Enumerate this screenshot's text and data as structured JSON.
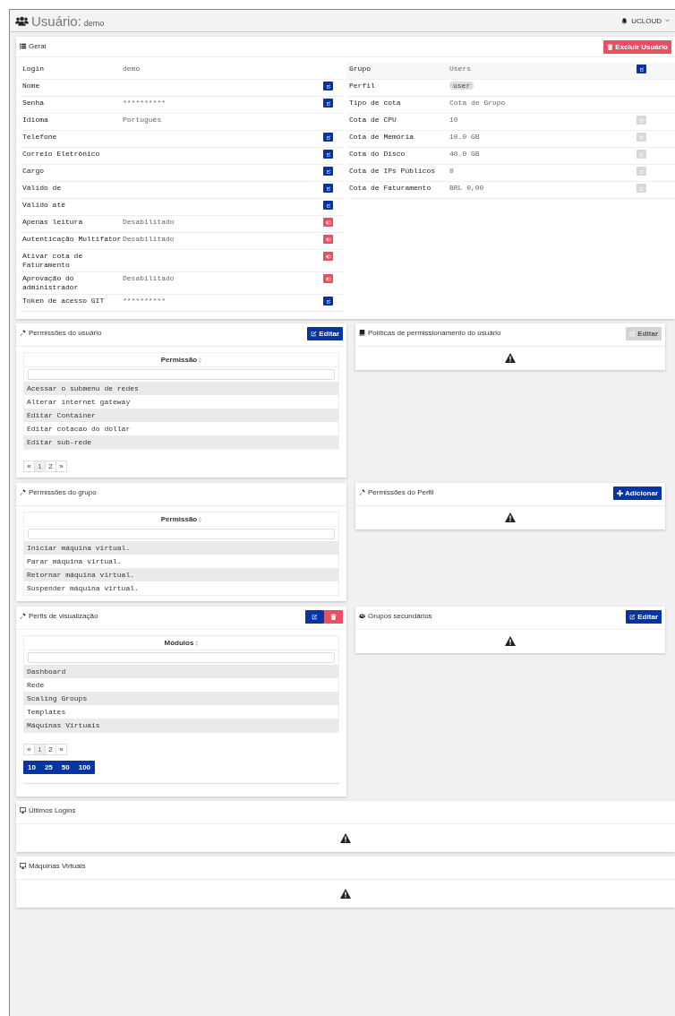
{
  "header": {
    "title": "Usuário:",
    "subtitle": "demo",
    "user": "UCLOUD"
  },
  "general": {
    "title": "Geral",
    "delete_button": "Excluir Usuário",
    "left_fields": [
      {
        "label": "Login",
        "value": "demo",
        "kind": "plain"
      },
      {
        "label": "Nome",
        "kind": "edit"
      },
      {
        "label": "Senha",
        "value": "**********",
        "kind": "edit"
      },
      {
        "label": "Idioma",
        "value": "Português",
        "kind": "plain"
      },
      {
        "label": "Telefone",
        "kind": "edit"
      },
      {
        "label": "Correio Eletrônico",
        "kind": "edit"
      },
      {
        "label": "Cargo",
        "kind": "edit"
      },
      {
        "label": "Válido de",
        "kind": "edit"
      },
      {
        "label": "Válido até",
        "kind": "edit"
      },
      {
        "label": "Apenas leitura",
        "value": "Desabilitado",
        "kind": "toggle"
      },
      {
        "label": "Autenticação Multifator",
        "value": "Desabilitado",
        "kind": "toggle"
      },
      {
        "label": "Ativar cota de Faturamento",
        "kind": "toggle"
      },
      {
        "label": "Aprovação do administrador",
        "value": "Desabilitado",
        "kind": "toggle"
      },
      {
        "label": "Token de acesso GIT",
        "value": "**********",
        "kind": "edit"
      }
    ],
    "right_fields": [
      {
        "label": "Grupo",
        "value": "Users",
        "kind": "edit",
        "disabled": false
      },
      {
        "label": "Perfil",
        "value": "user",
        "kind": "badge"
      },
      {
        "label": "Tipo de cota",
        "value": "Cota de Grupo",
        "kind": "plain"
      },
      {
        "label": "Cota de CPU",
        "value": "10",
        "kind": "edit",
        "disabled": true
      },
      {
        "label": "Cota de Memória",
        "value": "10.0 GB",
        "kind": "edit",
        "disabled": true
      },
      {
        "label": "Cota do Disco",
        "value": "40.0 GB",
        "kind": "edit",
        "disabled": true
      },
      {
        "label": "Cota de IPs Públicos",
        "value": "0",
        "kind": "edit",
        "disabled": true
      },
      {
        "label": "Cota de Faturamento",
        "value": "BRL 0,00",
        "kind": "edit",
        "disabled": true
      }
    ]
  },
  "panels": [
    {
      "title": "Permissões do usuário",
      "kind": "table",
      "buttons": [
        {
          "kind": "edit",
          "label": "Editar",
          "disabled": false
        }
      ],
      "column": "Permissão",
      "rows": [
        "Acessar o submenu de redes",
        "Alterar internet gateway",
        "Editar Container",
        "Editar cotacao do dollar",
        "Editar sub-rede"
      ],
      "pages": [
        {
          "label": "«",
          "selected": false
        },
        {
          "label": "1",
          "selected": true
        },
        {
          "label": "2",
          "selected": false
        },
        {
          "label": "»",
          "selected": false
        }
      ]
    },
    {
      "title": "Políticas de permissionamento do usuário",
      "kind": "empty",
      "buttons": [
        {
          "kind": "edit",
          "label": "Editar",
          "disabled": true
        }
      ]
    },
    {
      "title": "Permissões do grupo",
      "kind": "table",
      "column": "Permissão",
      "rows": [
        "Iniciar máquina virtual.",
        "Parar máquina virtual.",
        "Retornar máquina virtual.",
        "Suspender máquina virtual."
      ]
    },
    {
      "title": "Permissões do Perfil",
      "kind": "empty",
      "buttons": [
        {
          "kind": "add",
          "label": "Adicionar",
          "disabled": false
        }
      ]
    },
    {
      "title": "Perfis de visualização",
      "kind": "table",
      "buttons": [
        {
          "kind": "icon_edit",
          "disabled": false
        },
        {
          "kind": "icon_delete",
          "disabled": false
        }
      ],
      "column": "Módulos",
      "rows": [
        "Dashboard",
        "Rede",
        "Scaling Groups",
        "Templates",
        "Máquinas Virtuais"
      ],
      "pages": [
        {
          "label": "«",
          "selected": false
        },
        {
          "label": "1",
          "selected": true
        },
        {
          "label": "2",
          "selected": false
        },
        {
          "label": "»",
          "selected": false
        }
      ],
      "page_sizes": [
        "10",
        "25",
        "50",
        "100"
      ]
    },
    {
      "title": "Grupos secundários",
      "kind": "empty",
      "buttons": [
        {
          "kind": "edit",
          "label": "Editar",
          "disabled": false
        }
      ]
    }
  ],
  "bottom_panels": [
    {
      "title": "Últimos Logins"
    },
    {
      "title": "Máquinas Virtuais"
    }
  ]
}
